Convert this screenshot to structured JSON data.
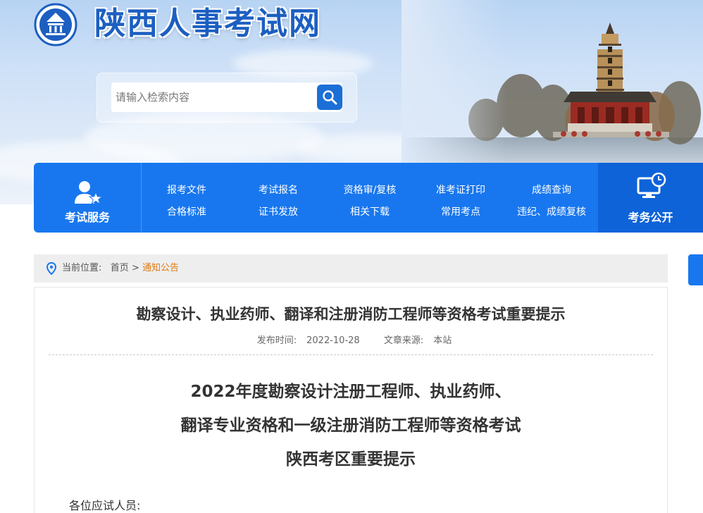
{
  "header": {
    "site_title": "陕西人事考试网",
    "search_placeholder": "请输入检索内容"
  },
  "nav": {
    "left_label": "考试服务",
    "right_label": "考务公开",
    "columns": [
      [
        "报考文件",
        "合格标准"
      ],
      [
        "考试报名",
        "证书发放"
      ],
      [
        "资格审/复核",
        "相关下载"
      ],
      [
        "准考证打印",
        "常用考点"
      ],
      [
        "成绩查询",
        "违纪、成绩复核"
      ]
    ]
  },
  "breadcrumb": {
    "prefix": "当前位置:",
    "home": "首页",
    "separator": ">",
    "current": "通知公告"
  },
  "article": {
    "title": "勘察设计、执业药师、翻译和注册消防工程师等资格考试重要提示",
    "publish_label": "发布时间:",
    "publish_date": "2022-10-28",
    "source_label": "文章来源:",
    "source": "本站",
    "headline_lines": [
      "2022年度勘察设计注册工程师、执业药师、",
      "翻译专业资格和一级注册消防工程师等资格考试",
      "陕西考区重要提示"
    ],
    "greeting": "各位应试人员:"
  },
  "colors": {
    "nav_blue": "#1877ef",
    "nav_dark": "#0e63d9",
    "title_blue": "#1c5fc1",
    "crumb_current": "#e07a12"
  }
}
